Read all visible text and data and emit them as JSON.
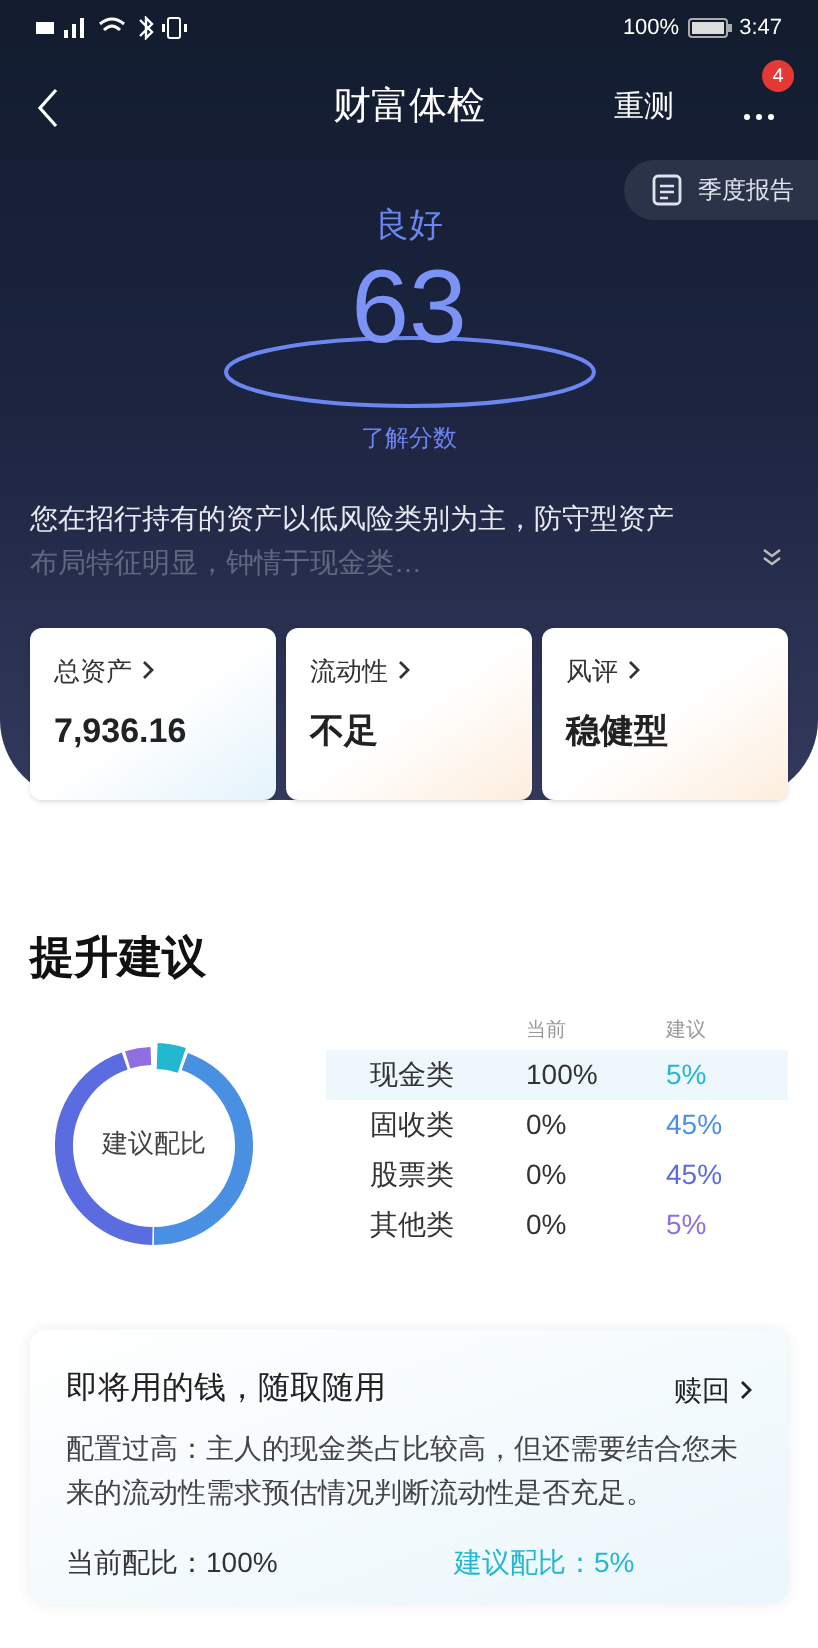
{
  "status_bar": {
    "battery": "100%",
    "time": "3:47"
  },
  "nav": {
    "title": "财富体检",
    "retest": "重测",
    "badge": "4"
  },
  "report_button": "季度报告",
  "score": {
    "grade": "良好",
    "value": "63",
    "link": "了解分数"
  },
  "summary": {
    "line_1": "您在招行持有的资产以低风险类别为主，防守型资产",
    "line_2": "布局特征明显，钟情于现金类…"
  },
  "stats": [
    {
      "label": "总资产",
      "value": "7,936.16"
    },
    {
      "label": "流动性",
      "value": "不足"
    },
    {
      "label": "风评",
      "value": "稳健型"
    }
  ],
  "advice": {
    "title": "提升建议",
    "donut_label": "建议配比",
    "col_current": "当前",
    "col_suggest": "建议",
    "rows": [
      {
        "name": "现金类",
        "current": "100%",
        "suggest": "5%",
        "color": "#22b8cf",
        "selected": true
      },
      {
        "name": "固收类",
        "current": "0%",
        "suggest": "45%",
        "color": "#4a90e2",
        "selected": false
      },
      {
        "name": "股票类",
        "current": "0%",
        "suggest": "45%",
        "color": "#5b6be0",
        "selected": false
      },
      {
        "name": "其他类",
        "current": "0%",
        "suggest": "5%",
        "color": "#8e6ee0",
        "selected": false
      }
    ]
  },
  "detail": {
    "title": "即将用的钱，随取随用",
    "action": "赎回",
    "text": "配置过高：主人的现金类占比较高，但还需要结合您未来的流动性需求预估情况判断流动性是否充足。",
    "current": "当前配比：100%",
    "suggest": "建议配比：5%"
  }
}
